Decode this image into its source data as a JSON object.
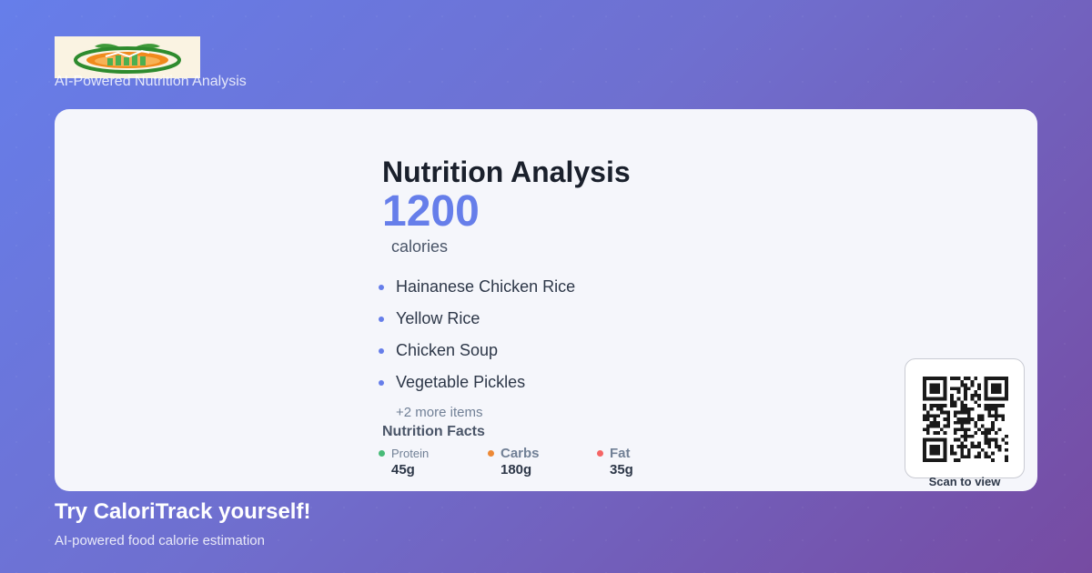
{
  "header": {
    "logo_icon": "fruit-logo-icon",
    "tagline": "AI-Powered Nutrition Analysis"
  },
  "analysis": {
    "title": "Nutrition Analysis",
    "calories": "1200",
    "calories_unit": "calories",
    "foods": [
      "Hainanese Chicken Rice",
      "Yellow Rice",
      "Chicken Soup",
      "Vegetable Pickles"
    ],
    "more_items": "+2 more items",
    "facts_title": "Nutrition Facts",
    "facts": [
      {
        "label": "Protein",
        "value": "45g",
        "color": "#48bb78"
      },
      {
        "label": "Carbs",
        "value": "180g",
        "color": "#ed8936"
      },
      {
        "label": "Fat",
        "value": "35g",
        "color": "#f56565"
      }
    ]
  },
  "qr": {
    "icon": "qr-code-icon",
    "caption": "Scan to view"
  },
  "footer": {
    "title": "Try CaloriTrack yourself!",
    "subtitle": "AI-powered food calorie estimation"
  },
  "colors": {
    "accent": "#667eea",
    "gradient_start": "#667eea",
    "gradient_end": "#764ba2"
  }
}
